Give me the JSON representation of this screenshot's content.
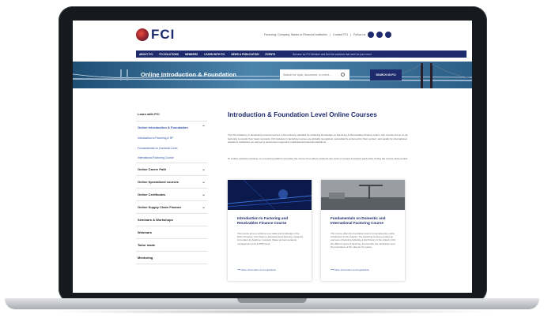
{
  "header": {
    "logo": "FCI",
    "logo_sub": "",
    "util": {
      "text": "Factoring: Company, Banks or Financial Institution",
      "contact": "Contact FCI",
      "follow": "Follow us"
    },
    "nav": [
      "ABOUT FCI",
      "FCI SOLUTIONS",
      "MEMBERS",
      "LEARN WITH FCI",
      "NEWS & PUBLICATION",
      "EVENTS"
    ],
    "promo": "Become an FCI Member and find the solutions that work for your need"
  },
  "hero": {
    "title": "Online Introduction & Foundation",
    "search_placeholder": "Search for topic, document, or event...",
    "search_button": "SEARCH ON FCI"
  },
  "sidebar": {
    "items": [
      {
        "label": "Learn with FCI",
        "chevron": false
      },
      {
        "label": "Online Introduction & Foundation",
        "chevron": true,
        "expanded": true
      },
      {
        "label": "Introduction to Factoring & RF",
        "sub": true
      },
      {
        "label": "Fundamentals on Domestic Level",
        "sub": true
      },
      {
        "label": "International Factoring Course",
        "sub": true
      },
      {
        "label": "Online Career Path",
        "chevron": true
      },
      {
        "label": "Online Specialised courses",
        "chevron": true
      },
      {
        "label": "Online Certificates",
        "chevron": true
      },
      {
        "label": "Online Supply Chain Finance",
        "chevron": true
      },
      {
        "label": "Seminars & Workshops",
        "chevron": false
      },
      {
        "label": "Webinars",
        "chevron": false
      },
      {
        "label": "Tailor made",
        "chevron": false
      },
      {
        "label": "Mentoring",
        "chevron": false
      }
    ]
  },
  "main": {
    "title": "Introduction & Foundation Level Online Courses",
    "para1": "The FCI Academy is developing several courses in the industry standard for obtaining knowledge on Factoring & Receivables Finance topics. Our courses focus on all factoring concepts from basic concepts. FCI Academy's factoring courses are globally recognized, accredited & endorsed for their content, and quality by international academic institutions as well as by well-known regional & multinational financial institutions.",
    "para2": "To further enhance learning, our e-learning platform provides the course from where students can work on project & support each other during the course study period.",
    "cards": [
      {
        "title": "Introduction to Factoring and Receivables Finance Course",
        "body": "This course aims to enhance your skills and knowledge in the field of Finance, from basic to advanced level factoring, designed to be taken by beginner, business (Sales and accountants), management (CLA & RTD) level.",
        "link": "More information and registration"
      },
      {
        "title": "Fundamentals on Domestic and International Factoring Course",
        "body": "This course offers the foundation level of comprehensive online introduction to the Industry. The Factoring Course provides an overview of factoring including a brief history of the industry, FCI, the different types of factoring, the benefits, the mechanism and the importance of the rules for its system.",
        "link": "More information and registration"
      }
    ]
  }
}
